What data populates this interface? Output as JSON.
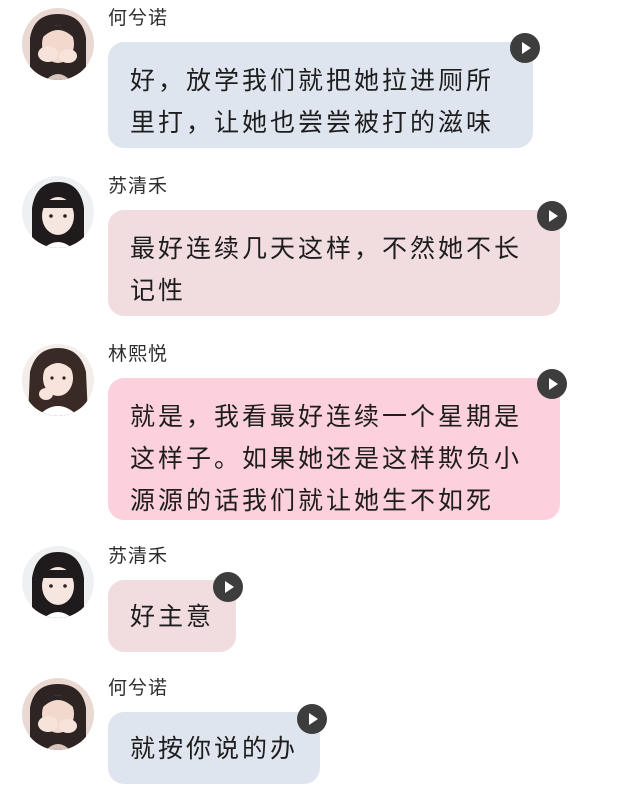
{
  "messages": [
    {
      "sender": "何兮诺",
      "text": "好，放学我们就把她拉进厕所里打，让她也尝尝被打的滋味",
      "color": "#dfe5ef",
      "avatar": "avatar-girl-hands"
    },
    {
      "sender": "苏清禾",
      "text": "最好连续几天这样，不然她不长记性",
      "color": "#f1dde0",
      "avatar": "avatar-girl-bangs"
    },
    {
      "sender": "林熙悦",
      "text": "就是，我看最好连续一个星期是这样子。如果她还是这样欺负小源源的话我们就让她生不如死",
      "color": "#fcd0dc",
      "avatar": "avatar-girl-long-hair"
    },
    {
      "sender": "苏清禾",
      "text": "好主意",
      "color": "#f1dde0",
      "avatar": "avatar-girl-bangs"
    },
    {
      "sender": "何兮诺",
      "text": "就按你说的办",
      "color": "#dfe5ef",
      "avatar": "avatar-girl-hands"
    }
  ],
  "icons": {
    "voice_play": "play-icon"
  }
}
